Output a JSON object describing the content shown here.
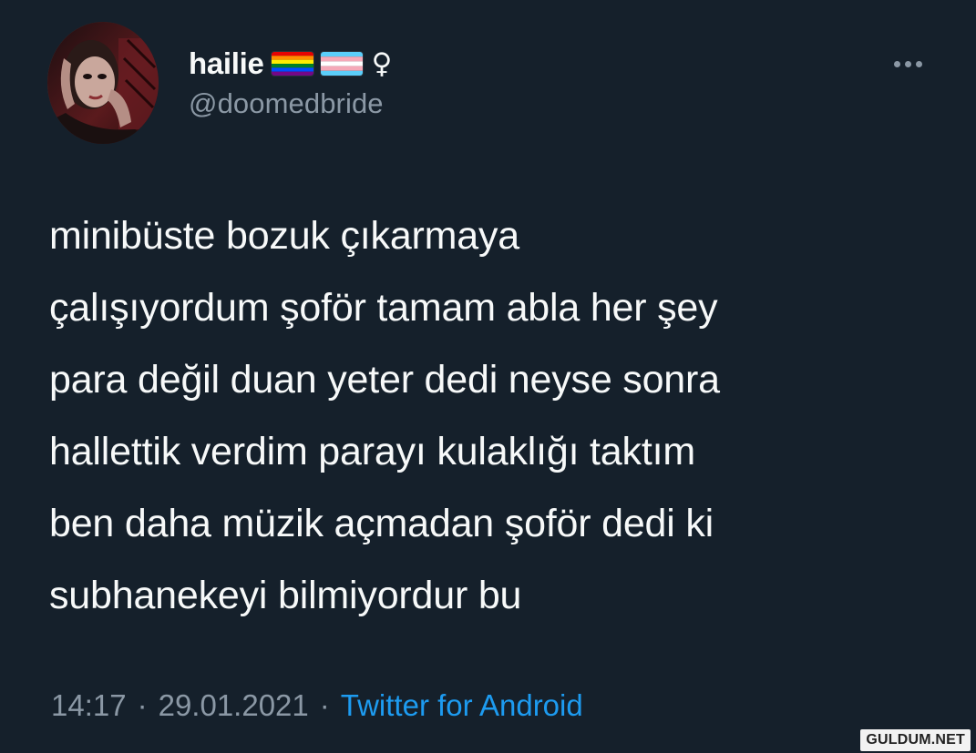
{
  "tweet": {
    "author": {
      "display_name": "hailie",
      "name_badges": [
        {
          "name": "rainbow-flag-icon"
        },
        {
          "name": "transgender-flag-icon"
        },
        {
          "name": "female-sign-icon",
          "glyph": "♀"
        }
      ],
      "handle": "@doomedbride",
      "avatar": "avatar-photo"
    },
    "more_icon": "more-icon",
    "text": "minibüste bozuk çıkarmaya\nçalışıyordum şoför tamam abla her şey\npara değil duan yeter dedi neyse sonra\nhallettik verdim parayı kulaklığı taktım\nben daha müzik açmadan şoför dedi ki\nsubhanekeyi bilmiyordur bu",
    "time": "14:17",
    "separator": "·",
    "date": "29.01.2021",
    "source": "Twitter for Android"
  },
  "watermark": "GULDUM.NET",
  "colors": {
    "background": "#15202b",
    "text": "#f7f9f9",
    "secondary": "#8b98a5",
    "link": "#1d9bf0"
  }
}
